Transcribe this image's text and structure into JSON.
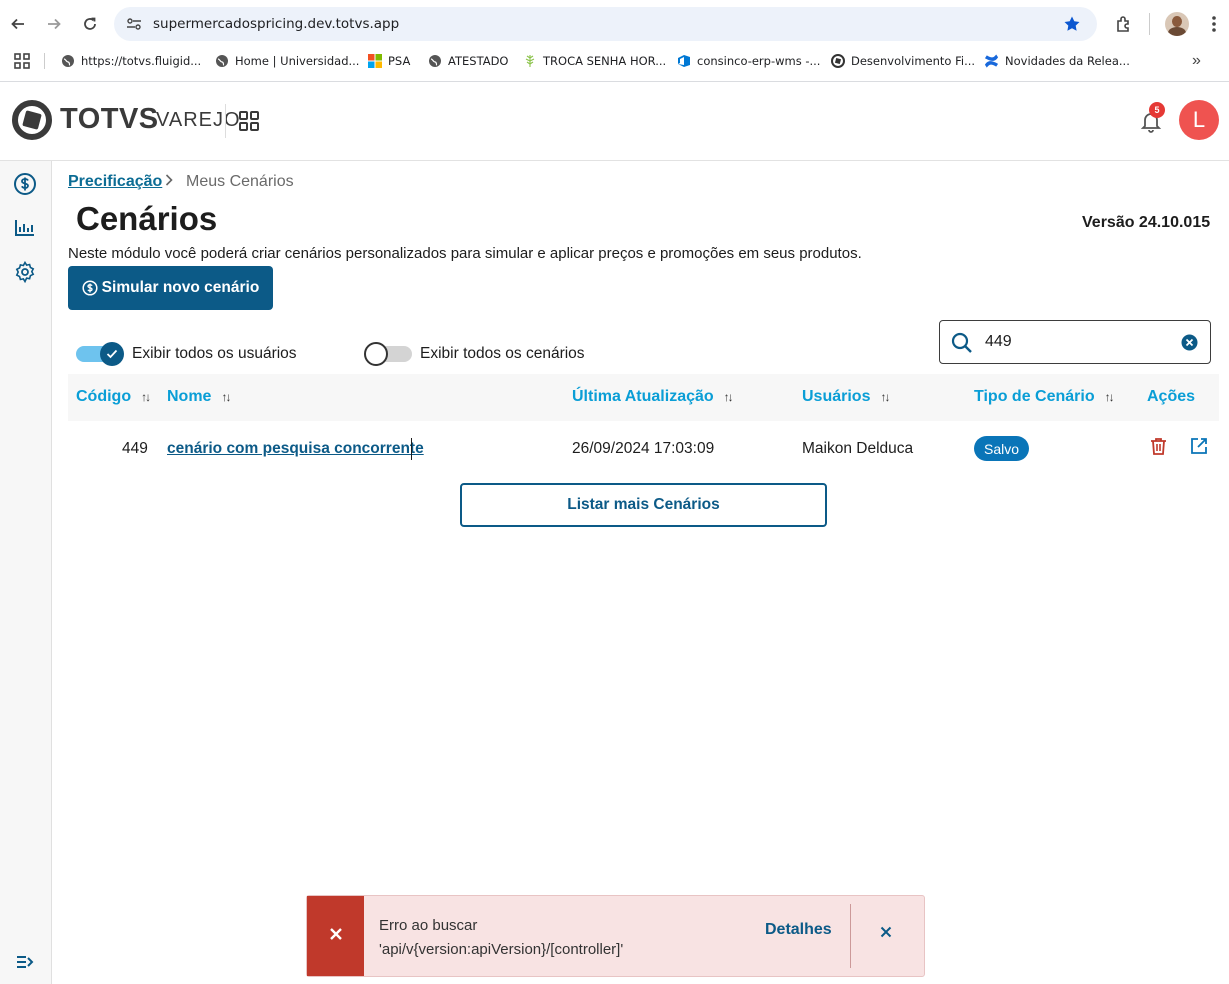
{
  "browser": {
    "url": "supermercadospricing.dev.totvs.app",
    "bookmarks": [
      {
        "label": "https://totvs.fluigid..."
      },
      {
        "label": "Home | Universidad..."
      },
      {
        "label": "PSA"
      },
      {
        "label": "ATESTADO"
      },
      {
        "label": "TROCA SENHA HOR..."
      },
      {
        "label": "consinco-erp-wms -..."
      },
      {
        "label": "Desenvolvimento Fi..."
      },
      {
        "label": "Novidades da Relea..."
      }
    ]
  },
  "header": {
    "logo_text": "TOTVS",
    "logo_sub": "VAREJO",
    "notification_count": "5",
    "avatar_initial": "L"
  },
  "breadcrumb": {
    "parent": "Precificação",
    "current": "Meus Cenários"
  },
  "page": {
    "title": "Cenários",
    "version": "Versão 24.10.015",
    "description": "Neste módulo você poderá criar cenários personalizados para simular e aplicar preços e promoções em seus produtos.",
    "new_button": "Simular novo cenário"
  },
  "filters": {
    "show_all_users": {
      "label": "Exibir todos os usuários",
      "checked": true
    },
    "show_all_scenarios": {
      "label": "Exibir todos os cenários",
      "checked": false
    },
    "search_value": "449"
  },
  "table": {
    "columns": [
      "Código",
      "Nome",
      "Última Atualização",
      "Usuários",
      "Tipo de Cenário",
      "Ações"
    ],
    "rows": [
      {
        "code": "449",
        "name": "cenário com pesquisa concorrente",
        "updated": "26/09/2024 17:03:09",
        "user": "Maikon Delduca",
        "type": "Salvo"
      }
    ],
    "more_button": "Listar mais Cenários"
  },
  "toast": {
    "message": "Erro ao buscar 'api/v{version:apiVersion}/[controller]'",
    "details_label": "Detalhes"
  },
  "colors": {
    "primary": "#0c5a87",
    "link": "#0a9ed6",
    "error": "#c0392b",
    "avatar": "#ef5350"
  }
}
